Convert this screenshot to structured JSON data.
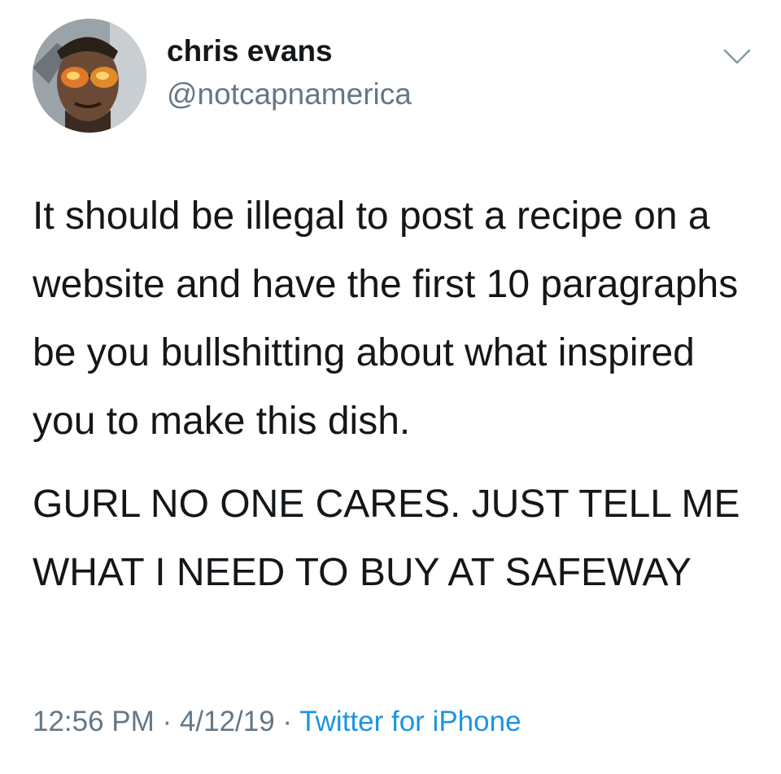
{
  "user": {
    "display_name": "chris evans",
    "handle": "@notcapnamerica"
  },
  "tweet": {
    "paragraph_1": "It should be illegal to post a recipe on a website and have the first 10 paragraphs be you bullshitting about what inspired you to make this dish.",
    "paragraph_2": "GURL NO ONE CARES.  JUST TELL ME WHAT I NEED TO BUY AT SAFEWAY"
  },
  "meta": {
    "time": "12:56 PM",
    "separator": " · ",
    "date": "4/12/19",
    "source": "Twitter for iPhone"
  },
  "icons": {
    "menu": "chevron-down-icon"
  },
  "colors": {
    "text": "#14171a",
    "secondary": "#657786",
    "link": "#1b95e0"
  }
}
